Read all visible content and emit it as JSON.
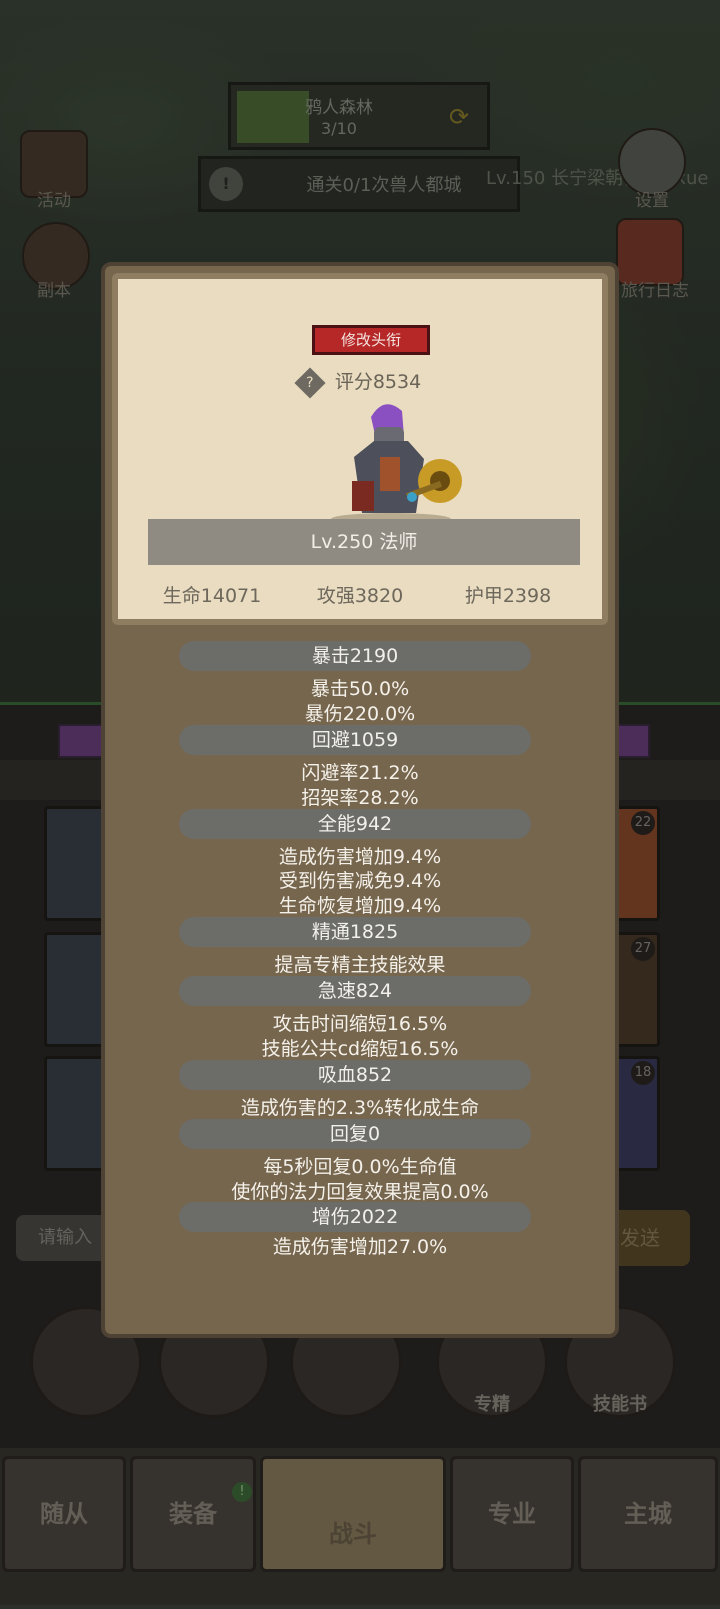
{
  "zone": {
    "name": "鸦人森林",
    "progress": "3/10"
  },
  "quest": {
    "text": "通关0/1次兽人都城"
  },
  "ticker": "Lv.150 长宁梁朝伟: daxue",
  "side_icons": [
    {
      "label": "活动",
      "icon": "event-book-icon"
    },
    {
      "label": "副本",
      "icon": "dungeon-portal-icon"
    },
    {
      "label": "设置",
      "icon": "gear-icon"
    },
    {
      "label": "旅行日志",
      "icon": "journal-icon"
    }
  ],
  "equip_badges": [
    "22",
    "27",
    "18"
  ],
  "chat": {
    "placeholder": "请输入",
    "send": "发送"
  },
  "skills": [
    {
      "label": "",
      "icon": "potion-icon"
    },
    {
      "label": "",
      "icon": "bread-icon"
    },
    {
      "label": "",
      "icon": "chest-icon"
    },
    {
      "label": "专精",
      "icon": "specialization-icon"
    },
    {
      "label": "技能书",
      "icon": "skill-book-icon"
    }
  ],
  "tabs": [
    {
      "label": "随从"
    },
    {
      "label": "装备",
      "badge": "!"
    },
    {
      "label": "战斗"
    },
    {
      "label": "专业"
    },
    {
      "label": "主城"
    }
  ],
  "profile": {
    "title_button": "修改头衔",
    "score": "评分8534",
    "level_class": "Lv.250 法师",
    "hp": "生命14071",
    "attack": "攻强3820",
    "armor": "护甲2398"
  },
  "stats": [
    {
      "head": "暴击2190",
      "lines": [
        "暴击50.0%",
        "暴伤220.0%"
      ]
    },
    {
      "head": "回避1059",
      "lines": [
        "闪避率21.2%",
        "招架率28.2%"
      ]
    },
    {
      "head": "全能942",
      "lines": [
        "造成伤害增加9.4%",
        "受到伤害减免9.4%",
        "生命恢复增加9.4%"
      ]
    },
    {
      "head": "精通1825",
      "lines": [
        "提高专精主技能效果"
      ]
    },
    {
      "head": "急速824",
      "lines": [
        "攻击时间缩短16.5%",
        "技能公共cd缩短16.5%"
      ]
    },
    {
      "head": "吸血852",
      "lines": [
        "造成伤害的2.3%转化成生命"
      ]
    },
    {
      "head": "回复0",
      "lines": [
        "每5秒回复0.0%生命值",
        "使你的法力回复效果提高0.0%"
      ]
    },
    {
      "head": "增伤2022",
      "lines": [
        "造成伤害增加27.0%"
      ]
    }
  ]
}
